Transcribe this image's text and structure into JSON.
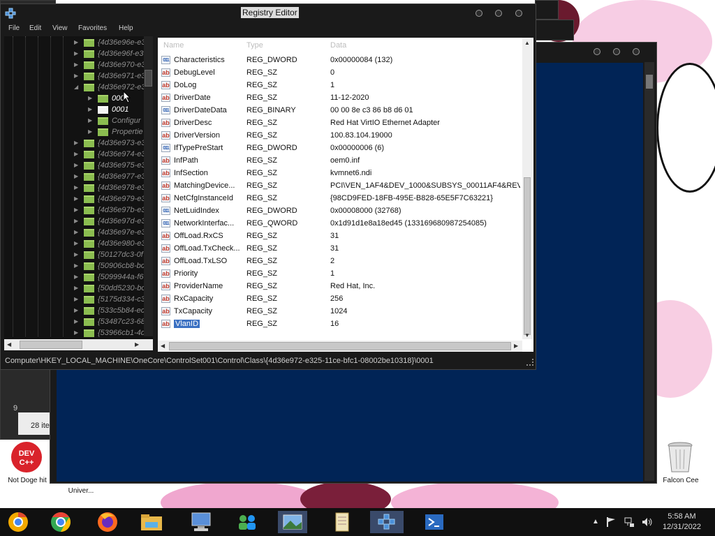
{
  "window": {
    "title": "Registry Editor",
    "menu": [
      "File",
      "Edit",
      "View",
      "Favorites",
      "Help"
    ]
  },
  "tree": {
    "items": [
      {
        "label": "{4d36e96e-e3",
        "level": 0
      },
      {
        "label": "{4d36e96f-e3",
        "level": 0
      },
      {
        "label": "{4d36e970-e3",
        "level": 0
      },
      {
        "label": "{4d36e971-e3",
        "level": 0
      },
      {
        "label": "{4d36e972-e3",
        "level": 0,
        "expanded": true
      },
      {
        "label": "000",
        "level": 1,
        "white": true
      },
      {
        "label": "0001",
        "level": 1,
        "white": true,
        "selected": true
      },
      {
        "label": "Configur",
        "level": 1
      },
      {
        "label": "Propertie",
        "level": 1
      },
      {
        "label": "{4d36e973-e3",
        "level": 0
      },
      {
        "label": "{4d36e974-e3",
        "level": 0
      },
      {
        "label": "{4d36e975-e3",
        "level": 0
      },
      {
        "label": "{4d36e977-e3",
        "level": 0
      },
      {
        "label": "{4d36e978-e3",
        "level": 0
      },
      {
        "label": "{4d36e979-e3",
        "level": 0
      },
      {
        "label": "{4d36e97b-e3",
        "level": 0
      },
      {
        "label": "{4d36e97d-e3",
        "level": 0
      },
      {
        "label": "{4d36e97e-e3",
        "level": 0
      },
      {
        "label": "{4d36e980-e3",
        "level": 0
      },
      {
        "label": "{50127dc3-0f",
        "level": 0
      },
      {
        "label": "{50906cb8-bc",
        "level": 0
      },
      {
        "label": "{5099944a-f6",
        "level": 0
      },
      {
        "label": "{50dd5230-bc",
        "level": 0
      },
      {
        "label": "{5175d334-c3",
        "level": 0
      },
      {
        "label": "{533c5b84-ec",
        "level": 0
      },
      {
        "label": "{53487c23-68",
        "level": 0
      },
      {
        "label": "{53966cb1-4d",
        "level": 0
      }
    ]
  },
  "values": {
    "headers": {
      "name": "Name",
      "type": "Type",
      "data": "Data"
    },
    "rows": [
      {
        "name": "Characteristics",
        "type": "REG_DWORD",
        "data": "0x00000084 (132)",
        "icon": "binary"
      },
      {
        "name": "DebugLevel",
        "type": "REG_SZ",
        "data": "0",
        "icon": "string"
      },
      {
        "name": "DoLog",
        "type": "REG_SZ",
        "data": "1",
        "icon": "string"
      },
      {
        "name": "DriverDate",
        "type": "REG_SZ",
        "data": "11-12-2020",
        "icon": "string"
      },
      {
        "name": "DriverDateData",
        "type": "REG_BINARY",
        "data": "00 00 8e c3 86 b8 d6 01",
        "icon": "binary"
      },
      {
        "name": "DriverDesc",
        "type": "REG_SZ",
        "data": "Red Hat VirtIO Ethernet Adapter",
        "icon": "string"
      },
      {
        "name": "DriverVersion",
        "type": "REG_SZ",
        "data": "100.83.104.19000",
        "icon": "string"
      },
      {
        "name": "IfTypePreStart",
        "type": "REG_DWORD",
        "data": "0x00000006 (6)",
        "icon": "binary"
      },
      {
        "name": "InfPath",
        "type": "REG_SZ",
        "data": "oem0.inf",
        "icon": "string"
      },
      {
        "name": "InfSection",
        "type": "REG_SZ",
        "data": "kvmnet6.ndi",
        "icon": "string"
      },
      {
        "name": "MatchingDevice...",
        "type": "REG_SZ",
        "data": "PCI\\VEN_1AF4&DEV_1000&SUBSYS_00011AF4&REV...",
        "icon": "string"
      },
      {
        "name": "NetCfgInstanceId",
        "type": "REG_SZ",
        "data": "{98CD9FED-18FB-495E-B828-65E5F7C63221}",
        "icon": "string"
      },
      {
        "name": "NetLuidIndex",
        "type": "REG_DWORD",
        "data": "0x00008000 (32768)",
        "icon": "binary"
      },
      {
        "name": "NetworkInterfac...",
        "type": "REG_QWORD",
        "data": "0x1d91d1e8a18ed45 (133169680987254085)",
        "icon": "binary"
      },
      {
        "name": "OffLoad.RxCS",
        "type": "REG_SZ",
        "data": "31",
        "icon": "string"
      },
      {
        "name": "OffLoad.TxCheck...",
        "type": "REG_SZ",
        "data": "31",
        "icon": "string"
      },
      {
        "name": "OffLoad.TxLSO",
        "type": "REG_SZ",
        "data": "2",
        "icon": "string"
      },
      {
        "name": "Priority",
        "type": "REG_SZ",
        "data": "1",
        "icon": "string"
      },
      {
        "name": "ProviderName",
        "type": "REG_SZ",
        "data": "Red Hat, Inc.",
        "icon": "string"
      },
      {
        "name": "RxCapacity",
        "type": "REG_SZ",
        "data": "256",
        "icon": "string"
      },
      {
        "name": "TxCapacity",
        "type": "REG_SZ",
        "data": "1024",
        "icon": "string"
      },
      {
        "name": "VlanID",
        "type": "REG_SZ",
        "data": "16",
        "icon": "string",
        "selected": true
      }
    ]
  },
  "status_path": "Computer\\HKEY_LOCAL_MACHINE\\OneCore\\ControlSet001\\Control\\Class\\{4d36e972-e325-11ce-bfc1-08002be10318}\\0001",
  "background": {
    "left_window_text_1": "9",
    "left_window_text_2": "28 ite"
  },
  "desktop": {
    "icons": [
      {
        "label": "Not Doge hit",
        "icon": "dev-cpp-icon",
        "icon_text": "DEV C++"
      },
      {
        "label": "Univer...",
        "icon": "app-icon"
      },
      {
        "label": "Falcon Cee",
        "icon": "recycle-bin-icon"
      }
    ]
  },
  "taskbar": {
    "apps": [
      "chrome-canary-icon",
      "chrome-icon",
      "firefox-icon",
      "file-explorer-icon",
      "computer-icon",
      "network-people-icon",
      "image-viewer-icon",
      "notepad-scroll-icon",
      "registry-editor-icon",
      "powershell-icon"
    ],
    "time": "5:58 AM",
    "date": "12/31/2022"
  },
  "colors": {
    "window_bg": "#1a1a1a",
    "console_bg": "#012456",
    "selection": "#3a70c2",
    "folder_green": "#8bbd50"
  }
}
